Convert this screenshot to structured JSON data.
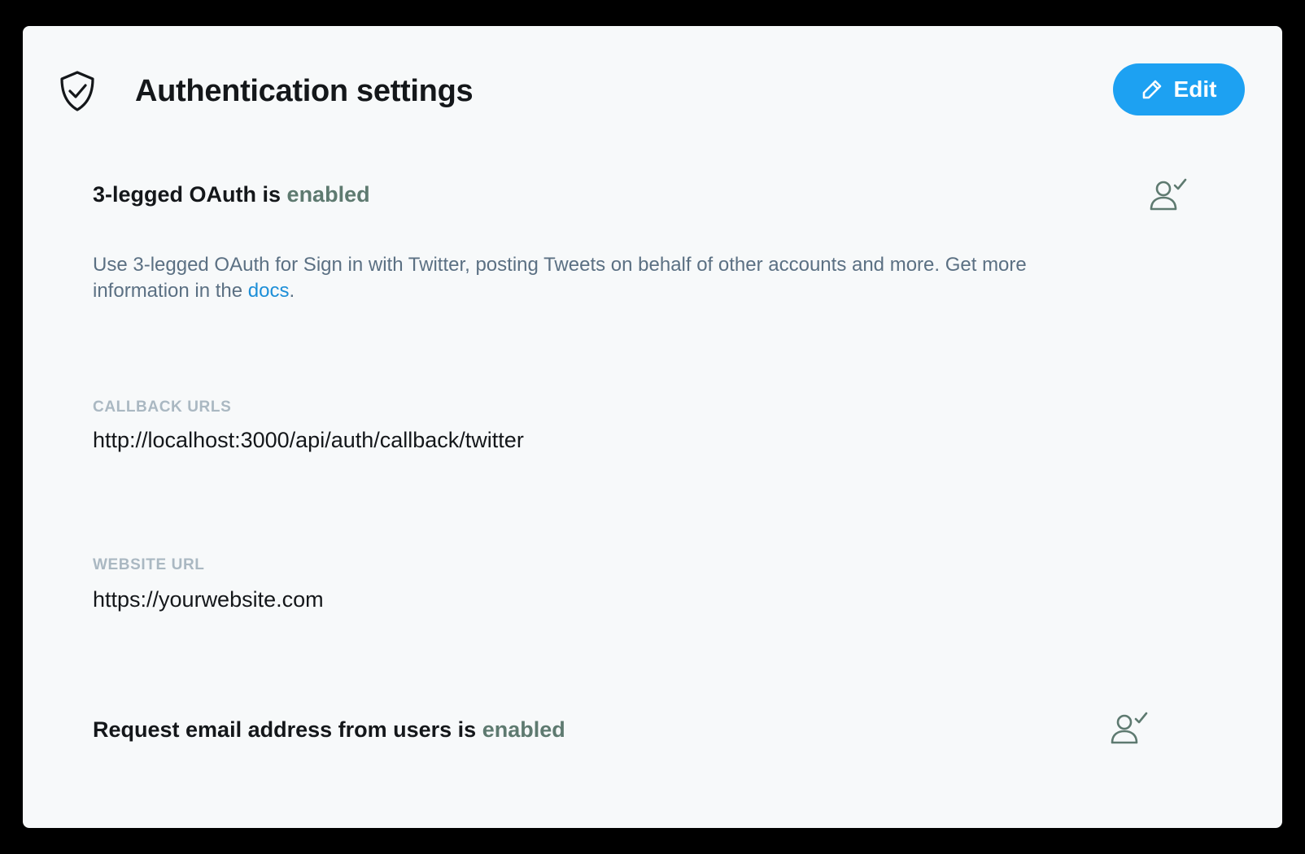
{
  "header": {
    "title": "Authentication settings",
    "edit_label": "Edit"
  },
  "oauth": {
    "heading_prefix": "3-legged OAuth is",
    "status": "enabled",
    "description": "Use 3-legged OAuth for Sign in with Twitter, posting Tweets on behalf of other accounts and more. Get more information in the",
    "docs_link": "docs",
    "description_end": "."
  },
  "callback": {
    "label": "CALLBACK URLS",
    "value": "http://localhost:3000/api/auth/callback/twitter"
  },
  "website": {
    "label": "WEBSITE URL",
    "value": "https://yourwebsite.com"
  },
  "email": {
    "heading_prefix": "Request email address from users is",
    "status": "enabled"
  },
  "colors": {
    "accent": "#1da1f2",
    "status_enabled": "#5e7a70",
    "label_gray": "#aab8c2",
    "card_background": "#f7f9fa"
  },
  "icons": {
    "header": "shield-check-icon",
    "edit": "pencil-icon",
    "oauth_status": "user-check-icon",
    "email_status": "user-check-icon"
  }
}
